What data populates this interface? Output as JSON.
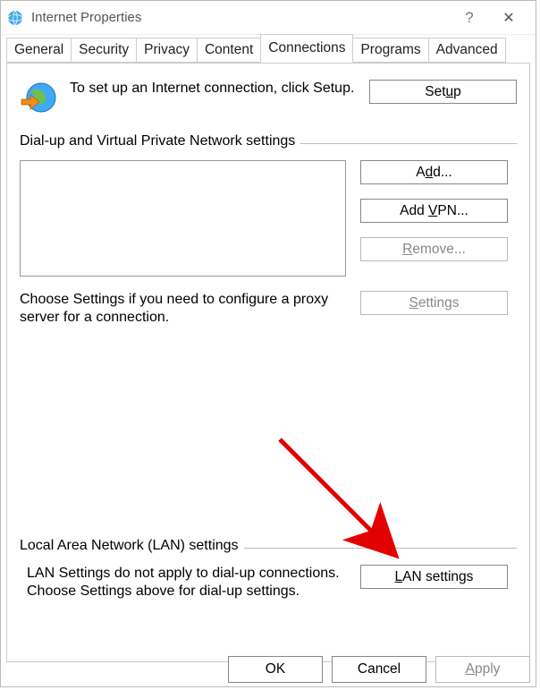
{
  "window": {
    "title": "Internet Properties",
    "help": "?",
    "close": "✕"
  },
  "tabs": {
    "items": [
      {
        "label": "General"
      },
      {
        "label": "Security"
      },
      {
        "label": "Privacy"
      },
      {
        "label": "Content"
      },
      {
        "label": "Connections"
      },
      {
        "label": "Programs"
      },
      {
        "label": "Advanced"
      }
    ],
    "active_index": 4
  },
  "setup": {
    "text": "To set up an Internet connection, click Setup.",
    "button": "Setup",
    "button_u_index": 3
  },
  "dialup": {
    "header": "Dial-up and Virtual Private Network settings",
    "add": "Add...",
    "add_u_index": 1,
    "add_vpn": "Add VPN...",
    "add_vpn_u_index": 4,
    "remove": "Remove...",
    "remove_u_index": 0,
    "settings": "Settings",
    "settings_u_index": 0,
    "choose_text": "Choose Settings if you need to configure a proxy server for a connection."
  },
  "lan": {
    "header": "Local Area Network (LAN) settings",
    "text": "LAN Settings do not apply to dial-up connections. Choose Settings above for dial-up settings.",
    "button": "LAN settings",
    "button_u_index": 0
  },
  "dialog": {
    "ok": "OK",
    "cancel": "Cancel",
    "apply": "Apply",
    "apply_u_index": 0
  }
}
